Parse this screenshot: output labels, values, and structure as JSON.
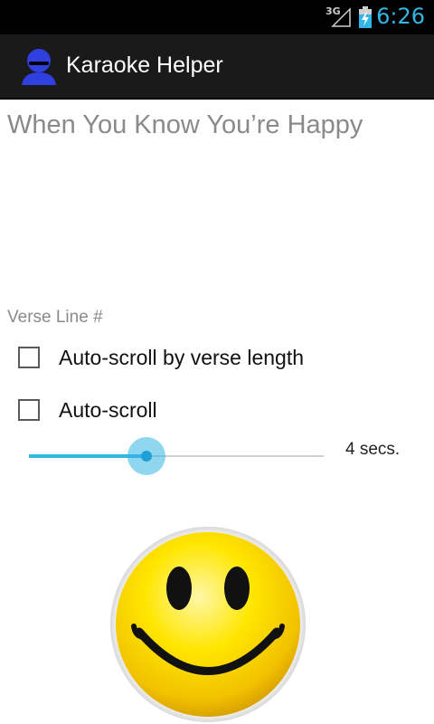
{
  "status_bar": {
    "network": "3G",
    "time": "6:26",
    "battery_level": 0.7
  },
  "action_bar": {
    "title": "Karaoke Helper",
    "icon": "user-avatar-icon"
  },
  "song": {
    "title": "When You Know You’re Happy"
  },
  "verse": {
    "label": "Verse Line #"
  },
  "options": {
    "auto_scroll_verse": {
      "label": "Auto-scroll by verse length",
      "checked": false
    },
    "auto_scroll": {
      "label": "Auto-scroll",
      "checked": false
    }
  },
  "slider": {
    "value_label": "4 secs.",
    "fraction": 0.4
  },
  "image": {
    "icon": "smiley-face-icon"
  },
  "colors": {
    "accent": "#33b5e5",
    "action_bar": "#1a1a1a",
    "muted_text": "#8a8a8a"
  }
}
